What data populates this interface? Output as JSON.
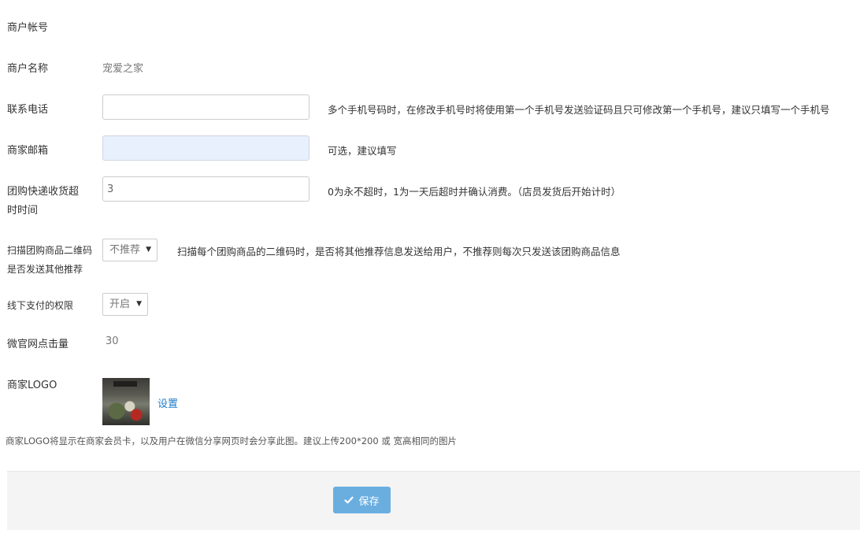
{
  "fields": {
    "account": {
      "label": "商户帐号"
    },
    "name": {
      "label": "商户名称",
      "value": "宠爱之家"
    },
    "phone": {
      "label": "联系电话",
      "value": "",
      "hint": "多个手机号码时，在修改手机号时将使用第一个手机号发送验证码且只可修改第一个手机号，建议只填写一个手机号"
    },
    "email": {
      "label": "商家邮箱",
      "value": "",
      "hint": "可选，建议填写"
    },
    "timeout": {
      "label_line1": "团购快递收货超",
      "label_line2": "时时间",
      "value": "3",
      "hint": "0为永不超时，1为一天后超时并确认消费。（店员发货后开始计时）"
    },
    "qr_recommend": {
      "label_line1": "扫描团购商品二维码",
      "label_line2": "是否发送其他推荐",
      "selected": "不推荐",
      "hint": "扫描每个团购商品的二维码时，是否将其他推荐信息发送给用户，不推荐则每次只发送该团购商品信息"
    },
    "offline_pay": {
      "label": "线下支付的权限",
      "selected": "开启"
    },
    "clicks": {
      "label": "微官网点击量",
      "value": "30"
    },
    "logo": {
      "label": "商家LOGO",
      "link": "设置",
      "note": "商家LOGO将显示在商家会员卡，以及用户在微信分享网页时会分享此图。建议上传200*200 或 宽高相同的图片"
    }
  },
  "actions": {
    "save_label": "保存",
    "save_icon": "check-icon",
    "save_color": "#6aaee0"
  },
  "colors": {
    "link": "#1e7cc8",
    "autofill_bg": "#e8f0fe"
  }
}
